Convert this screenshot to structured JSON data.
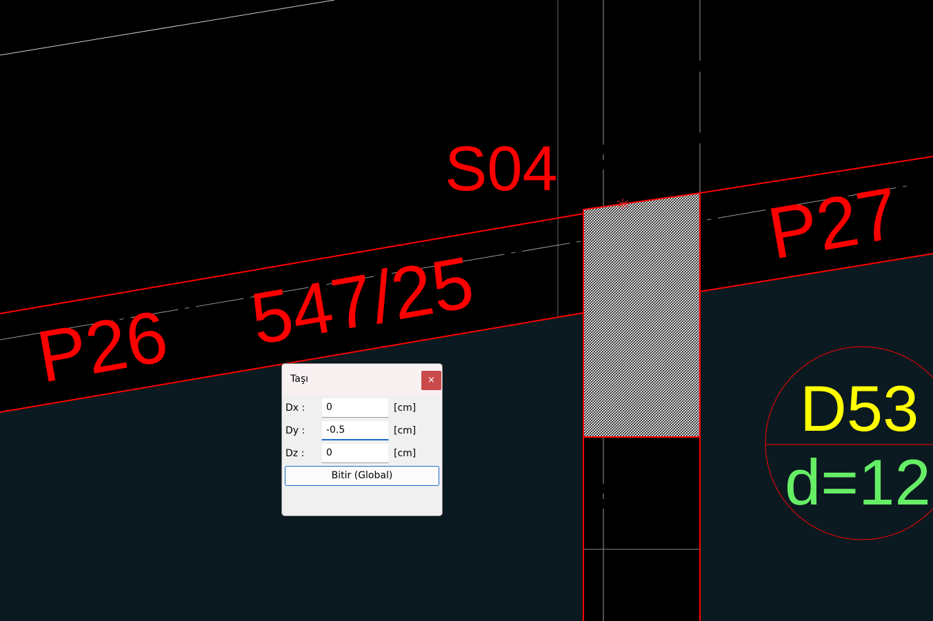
{
  "drawing": {
    "labels": {
      "s04": "S04",
      "p26": "P26",
      "beam_dim": "547/25",
      "p27": "P27",
      "d53": "D53",
      "d12": "d=12"
    },
    "colors": {
      "background": "#000000",
      "slab_fill": "#0b1a20",
      "red": "#ff0000",
      "yellow": "#ffff00",
      "green": "#66ee66",
      "guide": "#9a9a9a"
    }
  },
  "dialog": {
    "title": "Taşı",
    "close_glyph": "×",
    "fields": [
      {
        "label": "Dx :",
        "value": "0",
        "unit": "[cm]"
      },
      {
        "label": "Dy :",
        "value": "-0.5",
        "unit": "[cm]"
      },
      {
        "label": "Dz :",
        "value": "0",
        "unit": "[cm]"
      }
    ],
    "finish_button": "Bitir (Global)"
  }
}
